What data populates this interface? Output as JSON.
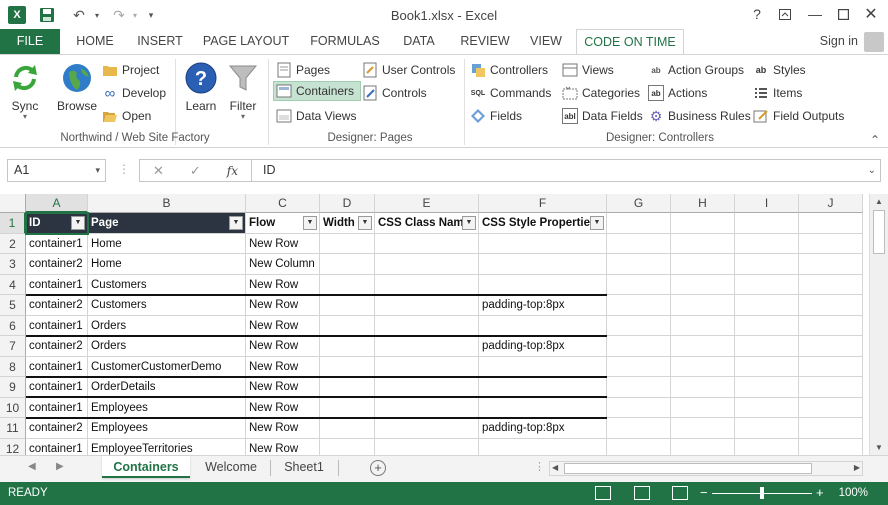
{
  "window": {
    "title": "Book1.xlsx - Excel",
    "app_logo": "X"
  },
  "quick_access": {
    "save_icon": "save-icon",
    "undo_icon": "undo-icon",
    "redo_icon": "redo-icon",
    "customize_icon": "customize-icon"
  },
  "ribbon_tabs": [
    {
      "label": "FILE"
    },
    {
      "label": "HOME"
    },
    {
      "label": "INSERT"
    },
    {
      "label": "PAGE LAYOUT"
    },
    {
      "label": "FORMULAS"
    },
    {
      "label": "DATA"
    },
    {
      "label": "REVIEW"
    },
    {
      "label": "VIEW"
    },
    {
      "label": "CODE ON TIME"
    }
  ],
  "sign_in": "Sign in",
  "ribbon": {
    "group1": {
      "label": "Northwind / Web Site Factory",
      "sync": "Sync",
      "browse": "Browse",
      "project": "Project",
      "develop": "Develop",
      "open": "Open",
      "learn": "Learn",
      "filter": "Filter"
    },
    "group2": {
      "label": "Designer: Pages",
      "pages": "Pages",
      "containers": "Containers",
      "data_views": "Data Views",
      "user_controls": "User Controls",
      "controls": "Controls"
    },
    "group3": {
      "label": "Designer: Controllers",
      "controllers": "Controllers",
      "commands": "Commands",
      "fields": "Fields",
      "views": "Views",
      "categories": "Categories",
      "data_fields": "Data Fields",
      "action_groups": "Action Groups",
      "actions": "Actions",
      "business_rules": "Business Rules",
      "styles": "Styles",
      "items": "Items",
      "field_outputs": "Field Outputs"
    }
  },
  "formula_bar": {
    "name_box": "A1",
    "value": "ID",
    "fx": "fx"
  },
  "columns": [
    "A",
    "B",
    "C",
    "D",
    "E",
    "F",
    "G",
    "H",
    "I",
    "J"
  ],
  "table_headers": [
    "ID",
    "Page",
    "Flow",
    "Width",
    "CSS Class Name",
    "CSS Style Properties"
  ],
  "rows": [
    {
      "num": "1"
    },
    {
      "num": "2",
      "id": "container1",
      "page": "Home",
      "flow": "New Row",
      "css": ""
    },
    {
      "num": "3",
      "id": "container2",
      "page": "Home",
      "flow": "New Column",
      "css": ""
    },
    {
      "num": "4",
      "id": "container1",
      "page": "Customers",
      "flow": "New Row",
      "css": ""
    },
    {
      "num": "5",
      "id": "container2",
      "page": "Customers",
      "flow": "New Row",
      "css": "padding-top:8px"
    },
    {
      "num": "6",
      "id": "container1",
      "page": "Orders",
      "flow": "New Row",
      "css": ""
    },
    {
      "num": "7",
      "id": "container2",
      "page": "Orders",
      "flow": "New Row",
      "css": "padding-top:8px"
    },
    {
      "num": "8",
      "id": "container1",
      "page": "CustomerCustomerDemo",
      "flow": "New Row",
      "css": ""
    },
    {
      "num": "9",
      "id": "container1",
      "page": "OrderDetails",
      "flow": "New Row",
      "css": ""
    },
    {
      "num": "10",
      "id": "container1",
      "page": "Employees",
      "flow": "New Row",
      "css": ""
    },
    {
      "num": "11",
      "id": "container2",
      "page": "Employees",
      "flow": "New Row",
      "css": "padding-top:8px"
    },
    {
      "num": "12",
      "id": "container1",
      "page": "EmployeeTerritories",
      "flow": "New Row",
      "css": ""
    }
  ],
  "sheets": [
    "Containers",
    "Welcome",
    "Sheet1"
  ],
  "status": {
    "ready": "READY",
    "zoom": "100%",
    "zoom_minus": "−",
    "zoom_plus": "+"
  },
  "colors": {
    "excel_green": "#217346",
    "table_header": "#2b3440"
  }
}
